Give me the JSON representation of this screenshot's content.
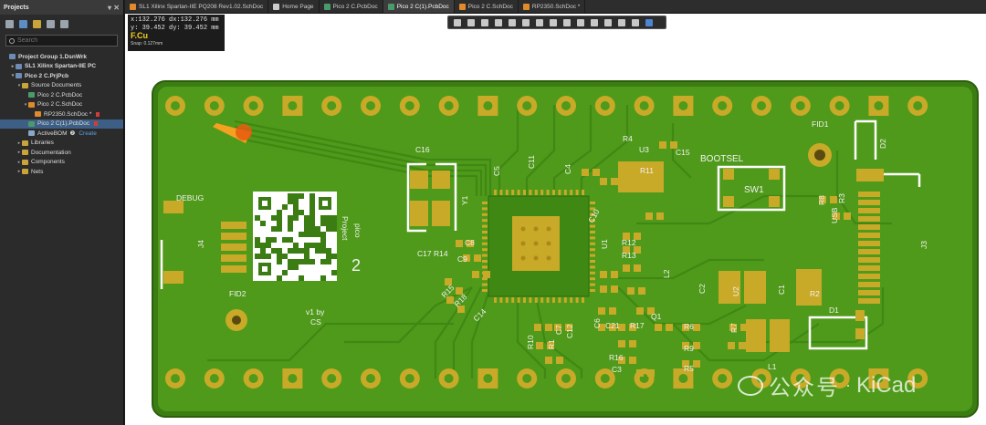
{
  "projects_panel": {
    "title": "Projects",
    "search_placeholder": "Search",
    "tree": [
      {
        "label": "Project Group 1.DsnWrk",
        "icon": "workspace-icon",
        "indent": 0,
        "caret": "",
        "bold": true
      },
      {
        "label": "SL1 Xilinx Spartan-IIE PC",
        "icon": "project-icon",
        "indent": 1,
        "caret": "▸",
        "bold": true
      },
      {
        "label": "Pico 2 C.PrjPcb",
        "icon": "project-icon",
        "indent": 1,
        "caret": "▾",
        "bold": true
      },
      {
        "label": "Source Documents",
        "icon": "folder-icon",
        "indent": 2,
        "caret": "▾",
        "bold": false
      },
      {
        "label": "Pico 2 C.PcbDoc",
        "icon": "pcb-doc-icon",
        "indent": 3,
        "caret": "",
        "bold": false
      },
      {
        "label": "Pico 2 C.SchDoc",
        "icon": "sch-doc-icon",
        "indent": 3,
        "caret": "▾",
        "bold": false
      },
      {
        "label": "RP2350.SchDoc *",
        "icon": "sch-doc-icon",
        "indent": 4,
        "caret": "",
        "bold": false,
        "modified": true
      },
      {
        "label": "Pico 2 C(1).PcbDoc",
        "icon": "pcb-doc-icon",
        "indent": 3,
        "caret": "",
        "bold": false,
        "selected": true,
        "modified": true
      },
      {
        "label": "ActiveBOM",
        "icon": "bom-icon",
        "indent": 3,
        "caret": "",
        "bold": false,
        "extra": "❷",
        "link": "Create"
      },
      {
        "label": "Libraries",
        "icon": "folder-icon",
        "indent": 2,
        "caret": "▸",
        "bold": false
      },
      {
        "label": "Documentation",
        "icon": "folder-icon",
        "indent": 2,
        "caret": "▸",
        "bold": false
      },
      {
        "label": "Components",
        "icon": "folder-icon",
        "indent": 2,
        "caret": "▸",
        "bold": false
      },
      {
        "label": "Nets",
        "icon": "folder-icon",
        "indent": 2,
        "caret": "▸",
        "bold": false
      }
    ]
  },
  "tabs": [
    {
      "label": "SL1 Xilinx Spartan-IIE PQ208 Rev1.02.SchDoc",
      "icon_color": "#e08a2c",
      "active": false
    },
    {
      "label": "Home Page",
      "icon_color": "#cccccc",
      "active": false
    },
    {
      "label": "Pico 2 C.PcbDoc",
      "icon_color": "#4a9b6b",
      "active": false
    },
    {
      "label": "Pico 2 C(1).PcbDoc",
      "icon_color": "#4a9b6b",
      "active": true
    },
    {
      "label": "Pico 2 C.SchDoc",
      "icon_color": "#e08a2c",
      "active": false
    },
    {
      "label": "RP2350.SchDoc *",
      "icon_color": "#e08a2c",
      "active": false
    }
  ],
  "hud": {
    "line1": "x:132.276  dx:132.276 mm",
    "line2": "y: 39.452   dy: 39.452  mm",
    "layer": "F.Cu",
    "snap": "Snap: 0.127mm"
  },
  "board": {
    "board_color": "#3b7d12",
    "pour_color": "#57a520",
    "pad_color": "#c9a928",
    "text_color": "#f2f2f2",
    "silk_color": "#ffffff",
    "labels": {
      "debug": "DEBUG",
      "j4": "J4",
      "fid2": "FID2",
      "fid1": "FID1",
      "c16": "C16",
      "c17_r14": "C17 R14",
      "c5": "C5",
      "c11": "C11",
      "c8": "C8",
      "y1": "Y1",
      "c9": "C9",
      "c4": "C4",
      "c10": "C10",
      "r4": "R4",
      "u3": "U3",
      "c15": "C15",
      "r11": "R11",
      "bootsel": "BOOTSEL",
      "sw1": "SW1",
      "d2": "D2",
      "j3": "J3",
      "usb": "USB",
      "r8": "R8",
      "r3": "R3",
      "u1": "U1",
      "r12": "R12",
      "r13": "R13",
      "l2": "L2",
      "c2": "C2",
      "u2": "U2",
      "c1": "C1",
      "r2": "R2",
      "d1": "D1",
      "c6": "C6",
      "r15": "R15",
      "r18": "R18",
      "c14": "C14",
      "c7": "C7",
      "c12": "C12",
      "c21": "C21",
      "r17": "R17",
      "q1": "Q1",
      "r6": "R6",
      "r9": "R9",
      "r7": "R7",
      "l1": "L1",
      "r10": "R10",
      "r1": "R1",
      "r16": "R16",
      "c3": "C3",
      "r5": "R5",
      "version": "v1 by",
      "author": "CS",
      "project": "Project",
      "pico": "pico",
      "two": "2"
    }
  },
  "watermark": {
    "brand": "公众号",
    "separator": "·",
    "name": "KiCad"
  }
}
